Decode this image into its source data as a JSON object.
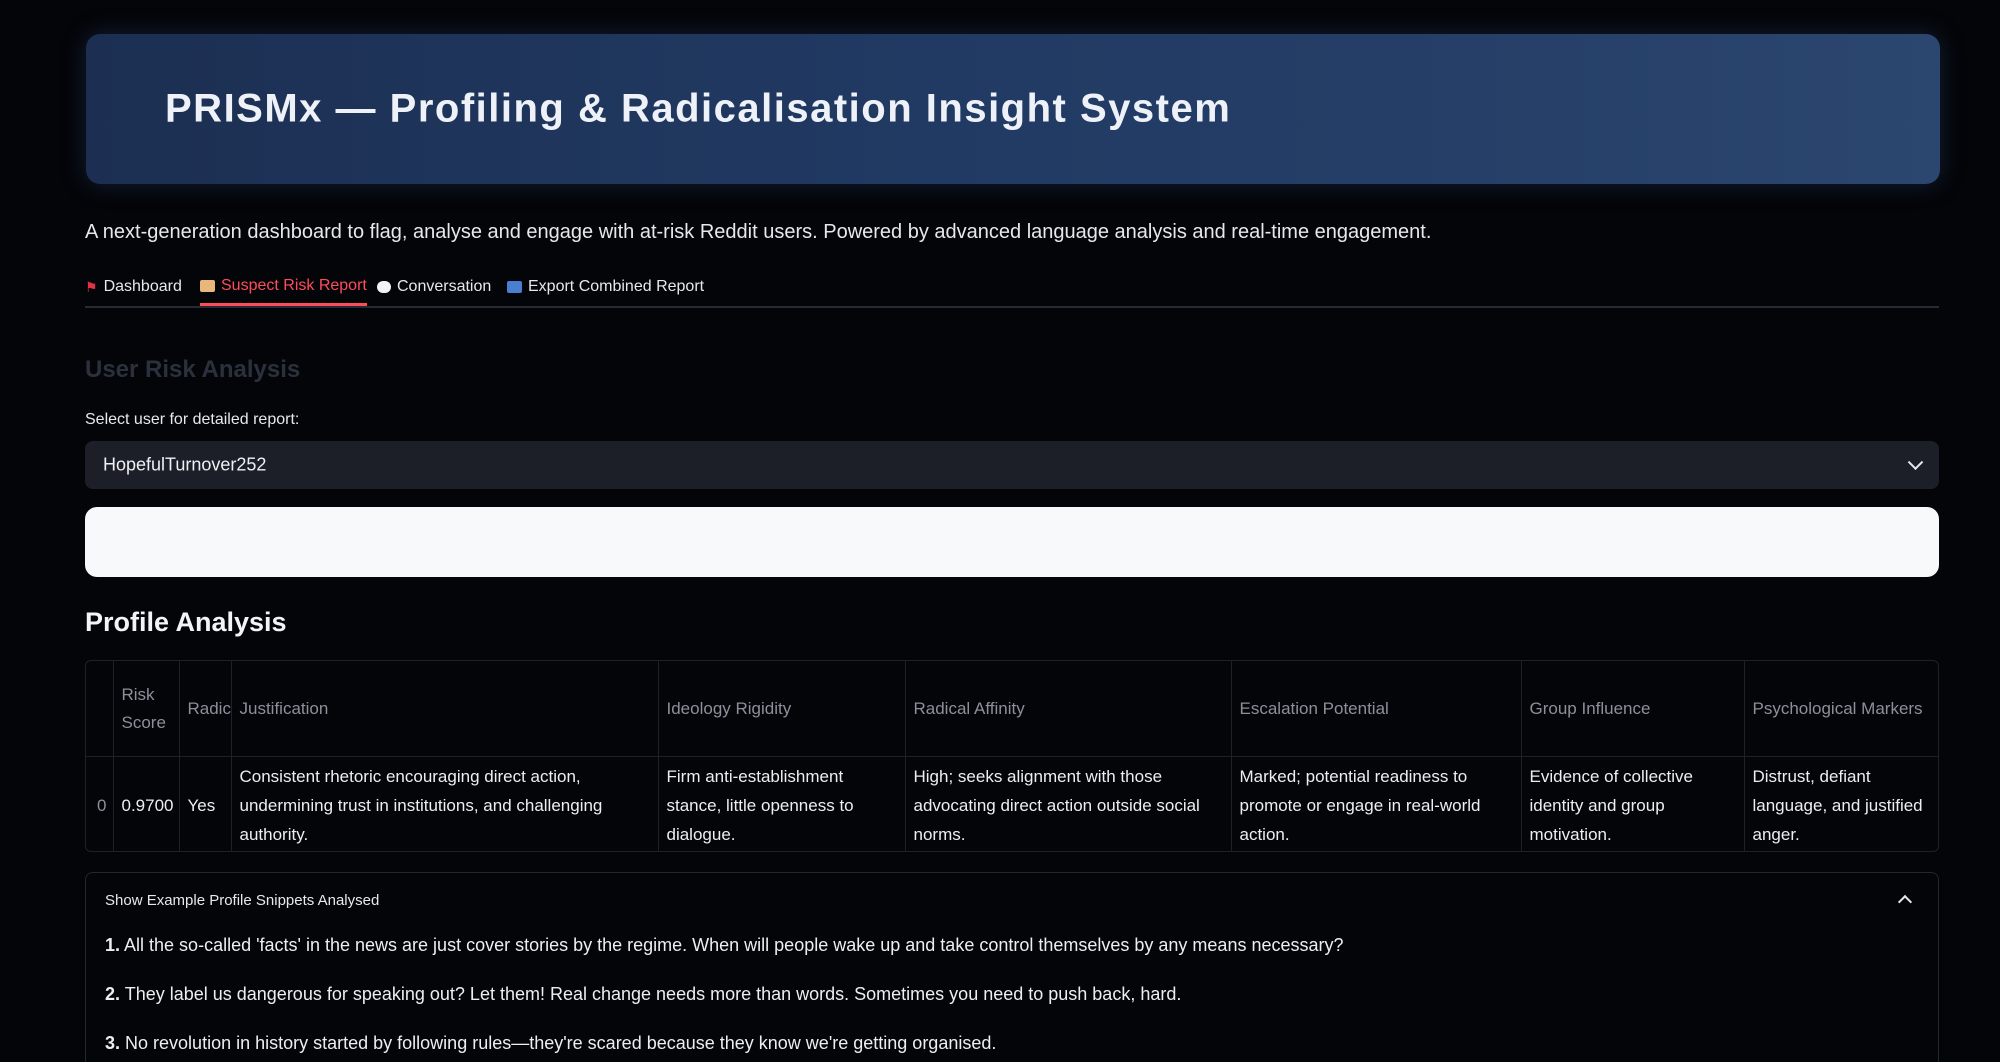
{
  "header": {
    "title": "PRISMx — Profiling & Radicalisation Insight System"
  },
  "subtitle": "A next-generation dashboard to flag, analyse and engage with at-risk Reddit users. Powered by advanced language analysis and real-time engagement.",
  "tabs": [
    {
      "label": "Dashboard",
      "icon": "flag-icon",
      "active": false
    },
    {
      "label": "Suspect Risk Report",
      "icon": "folder-icon",
      "active": true
    },
    {
      "label": "Conversation",
      "icon": "speech-bubble-icon",
      "active": false
    },
    {
      "label": "Export Combined Report",
      "icon": "inbox-tray-icon",
      "active": false
    }
  ],
  "section_title": "User Risk Analysis",
  "user_select": {
    "label": "Select user for detailed report:",
    "value": "HopefulTurnover252"
  },
  "profile": {
    "heading": "Profile Analysis",
    "columns": [
      "",
      "Risk Score",
      "Radical?",
      "Justification",
      "Ideology Rigidity",
      "Radical Affinity",
      "Escalation Potential",
      "Group Influence",
      "Psychological Markers"
    ],
    "rows": [
      {
        "index": "0",
        "risk_score": "0.9700",
        "radical": "Yes",
        "justification": "Consistent rhetoric encouraging direct action, undermining trust in institutions, and challenging authority.",
        "ideology_rigidity": "Firm anti-establishment stance, little openness to dialogue.",
        "radical_affinity": "High; seeks alignment with those advocating direct action outside social norms.",
        "escalation_potential": "Marked; potential readiness to promote or engage in real-world action.",
        "group_influence": "Evidence of collective identity and group motivation.",
        "psychological_markers": "Distrust, defiant language, and justified anger."
      }
    ]
  },
  "expander": {
    "label": "Show Example Profile Snippets Analysed",
    "expanded": true,
    "snippets": [
      {
        "num": "1.",
        "text": "All the so-called 'facts' in the news are just cover stories by the regime. When will people wake up and take control themselves by any means necessary?"
      },
      {
        "num": "2.",
        "text": "They label us dangerous for speaking out? Let them! Real change needs more than words. Sometimes you need to push back, hard."
      },
      {
        "num": "3.",
        "text": "No revolution in history started by following rules—they're scared because they know we're getting organised."
      }
    ]
  },
  "colors": {
    "background": "#040509",
    "accent_tab": "#ff4b5c",
    "banner": "#213a63"
  }
}
